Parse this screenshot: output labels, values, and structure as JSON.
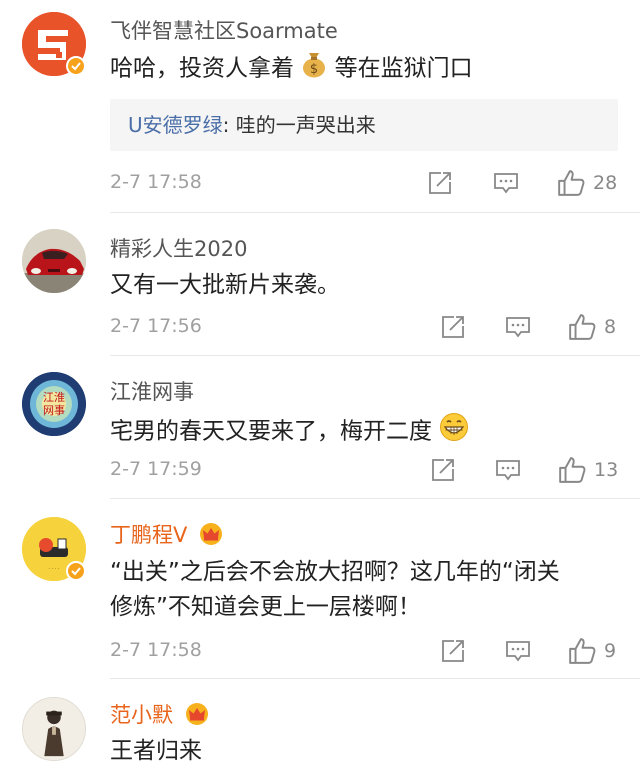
{
  "comments": [
    {
      "name": "飞伴智慧社区Soarmate",
      "text_before": "哈哈，投资人拿着",
      "text_after": "等在监狱门口",
      "reply": {
        "user": "U安德罗绿",
        "sep": ": ",
        "text": "哇的一声哭出来"
      },
      "time": "2-7 17:58",
      "likes": "28"
    },
    {
      "name": "精彩人生2020",
      "text": "又有一大批新片来袭。",
      "time": "2-7 17:56",
      "likes": "8"
    },
    {
      "name": "江淮网事",
      "avatar_text": "江淮网事",
      "text": "宅男的春天又要来了，梅开二度",
      "time": "2-7 17:59",
      "likes": "13"
    },
    {
      "name": "丁鹏程V",
      "text_line1": "“出关”之后会不会放大招啊？这几年的“闭关",
      "text_line2": "修炼”不知道会更上一层楼啊！",
      "time": "2-7 17:58",
      "likes": "9"
    },
    {
      "name": "范小默",
      "text": "王者归来"
    }
  ],
  "icons": {
    "share": "share-icon",
    "comment": "comment-icon",
    "like": "thumbs-up-icon",
    "verified": "verified-icon",
    "crown": "vip-crown-icon",
    "money": "money-bag-emoji",
    "grin": "grin-emoji"
  },
  "colors": {
    "name_gray": "#555555",
    "name_vip": "#e8641b",
    "reply_user": "#4a6ea8",
    "meta": "#a0a0a0",
    "verified_badge": "#f6a21a"
  }
}
